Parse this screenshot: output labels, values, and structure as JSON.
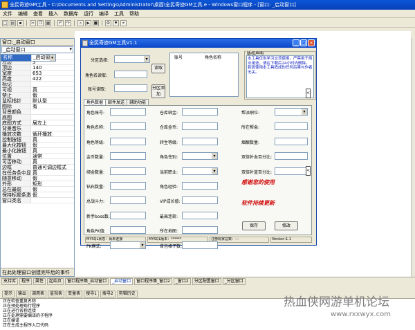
{
  "window": {
    "title": "全民奇迹GM工具 - C:\\Documents and Settings\\Administrator\\桌面\\全民奇迹GM工具.e - Windows窗口程序 - [窗口: _启动窗口]"
  },
  "menu": [
    "文件",
    "编辑",
    "查看",
    "插入",
    "数据库",
    "运行",
    "编译",
    "工具",
    "帮助"
  ],
  "props": {
    "header": "窗口:_启动窗口",
    "combo": "_启动窗口",
    "rows": [
      [
        "名称",
        "_启动窗口"
      ],
      [
        "备注",
        ""
      ],
      [
        "左边",
        "3"
      ],
      [
        "顶边",
        "140"
      ],
      [
        "宽度",
        "653"
      ],
      [
        "高度",
        "422"
      ],
      [
        "标记",
        ""
      ],
      [
        "可视",
        "真"
      ],
      [
        "禁止",
        "假"
      ],
      [
        "鼠标指针",
        "默认型"
      ],
      [
        "图标",
        "有"
      ],
      [
        "背景颜色",
        ""
      ],
      [
        "底图",
        ""
      ],
      [
        "底图方式",
        "居左上"
      ],
      [
        "背景音乐",
        ""
      ],
      [
        "播放次数",
        "循环播放"
      ],
      [
        "控制按钮",
        "真"
      ],
      [
        "最大化按钮",
        "假"
      ],
      [
        "最小化按钮",
        "真"
      ],
      [
        "位置",
        "通常"
      ],
      [
        "可否移动",
        "真"
      ],
      [
        "边框",
        "普通可调边框式"
      ],
      [
        "在任务条中显示",
        "真"
      ],
      [
        "随意移动",
        "假"
      ],
      [
        "外形",
        "矩形"
      ],
      [
        "总在最前",
        "假"
      ],
      [
        "保持标题条激活",
        "假"
      ],
      [
        "窗口类名",
        ""
      ]
    ],
    "desc": "在此处理窗口创建完毕后的事件"
  },
  "dialog": {
    "title": "全民奇迹GM工具V1.1",
    "server_label": "分区选择:",
    "charname_label": "角色名读取:",
    "acct_label": "账号读取:",
    "read_btn": "读取",
    "add_btn": "分区添加",
    "col_account": "账号",
    "col_charname": "角色名称",
    "notice_title": "版权声明",
    "notice_text": "本工具仅供学习交流使用，严禁用于商业用途，请在下载后24小时内删除。若因使用本工具造成的任何后果与作者无关。",
    "tabs": [
      "角色数据",
      "邮件发送",
      "辅助功能"
    ],
    "fields_left": [
      "角色账号:",
      "角色名称:",
      "角色等级:",
      "金币数量:",
      "绑金数量:",
      "钻石数量:",
      "总战斗力:",
      "新手boss数:",
      "角色PK值:",
      "PK模式:"
    ],
    "fields_mid": [
      "仓库绑金:",
      "仓库金币:",
      "转生等级:",
      "角色性别:",
      "当前职业:",
      "角色经验:",
      "VIP成长值:",
      "最高连斩:",
      "所在地图:",
      "背包格子数:"
    ],
    "fields_right": [
      "帮派职位:",
      "所在帮会:",
      "烟酿数量:",
      "双倍补血百分比:",
      "双倍补蓝百分比:"
    ],
    "thanks": "感谢您的使用",
    "update": "软件持续更新",
    "save_btn": "保存",
    "modify_btn": "修改",
    "status": [
      "MYSQL状态：尚未连接",
      "MYSQL版本：******",
      "注册玩家总数：---",
      "Version:1.1"
    ]
  },
  "bottom_tabs": [
    "支持库",
    "程序",
    "属性",
    "起始页",
    "窗口程序集_启动窗口",
    "_启动窗口",
    "窗口程序集_窗口2",
    "_窗口2",
    "分区配置窗口",
    "_分区窗口"
  ],
  "console_tabs": [
    "提示",
    "输出",
    "调用表",
    "监视表",
    "变量表",
    "搜寻1",
    "搜寻2",
    "剪辑历史"
  ],
  "output": [
    "正在检查重复名称",
    "正在预处理现行程序",
    "正在进行名称连接",
    "正在处理需要编译的子程序",
    "正在编译",
    "正在生成主程序入口代码",
    "正在生成可执行文件"
  ],
  "watermark": "热血侠网游单机论坛",
  "watermark_url": "www.rxxwyx.com"
}
